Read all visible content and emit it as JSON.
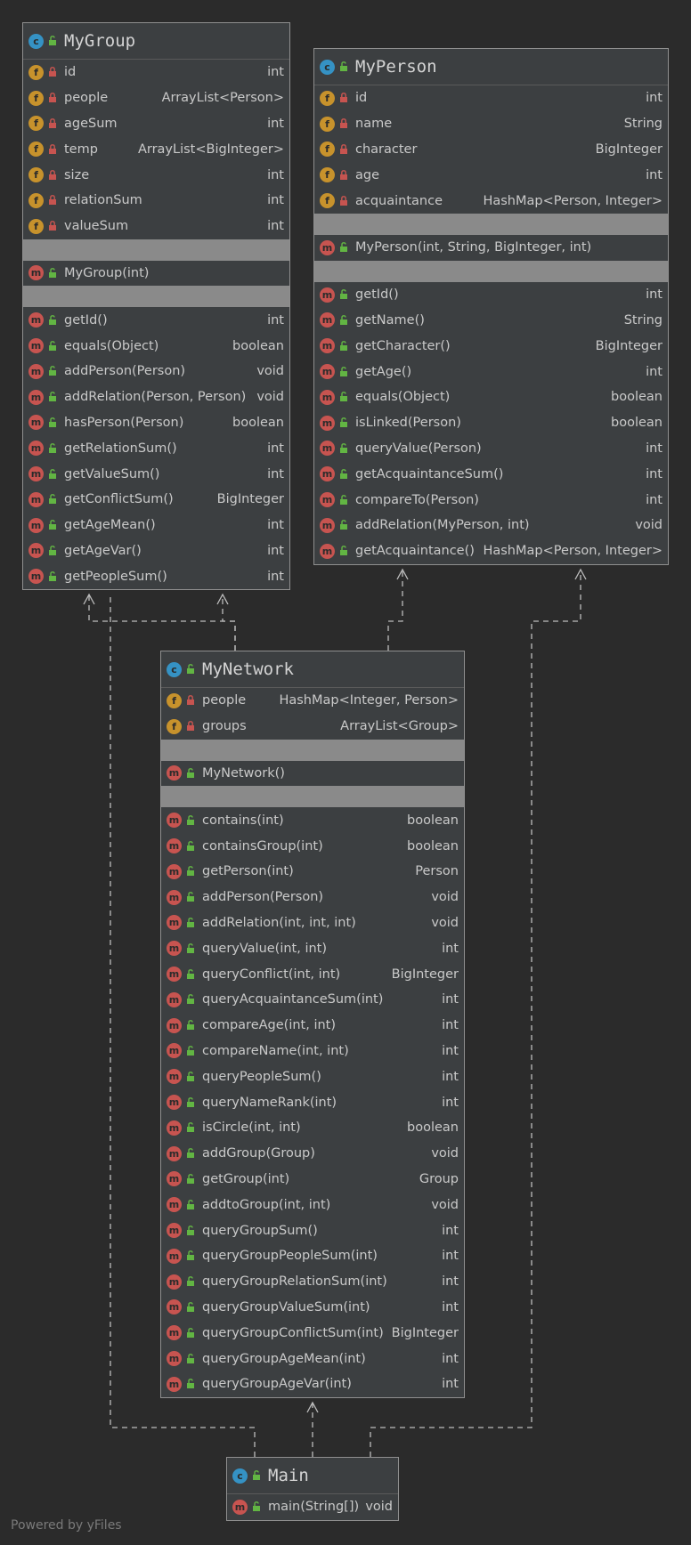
{
  "footer": "Powered by yFiles",
  "colors": {
    "background": "#2b2b2b",
    "box": "#3c3f41",
    "border": "#8f8f8f",
    "class_badge": "#3592c4",
    "field_badge": "#c7922c",
    "method_badge": "#c75450",
    "private_lock": "#c75450",
    "public_lock": "#62b543"
  },
  "icons": {
    "class": "class-badge-icon",
    "field": "field-badge-icon",
    "method": "method-badge-icon",
    "private": "lock-closed-icon",
    "public": "lock-open-icon"
  },
  "classes": {
    "group": {
      "name": "MyGroup",
      "fields": [
        {
          "name": "id",
          "type": "int"
        },
        {
          "name": "people",
          "type": "ArrayList<Person>"
        },
        {
          "name": "ageSum",
          "type": "int"
        },
        {
          "name": "temp",
          "type": "ArrayList<BigInteger>"
        },
        {
          "name": "size",
          "type": "int"
        },
        {
          "name": "relationSum",
          "type": "int"
        },
        {
          "name": "valueSum",
          "type": "int"
        }
      ],
      "constructors": [
        {
          "name": "MyGroup(int)",
          "type": ""
        }
      ],
      "methods": [
        {
          "name": "getId()",
          "type": "int"
        },
        {
          "name": "equals(Object)",
          "type": "boolean"
        },
        {
          "name": "addPerson(Person)",
          "type": "void"
        },
        {
          "name": "addRelation(Person, Person)",
          "type": "void"
        },
        {
          "name": "hasPerson(Person)",
          "type": "boolean"
        },
        {
          "name": "getRelationSum()",
          "type": "int"
        },
        {
          "name": "getValueSum()",
          "type": "int"
        },
        {
          "name": "getConflictSum()",
          "type": "BigInteger"
        },
        {
          "name": "getAgeMean()",
          "type": "int"
        },
        {
          "name": "getAgeVar()",
          "type": "int"
        },
        {
          "name": "getPeopleSum()",
          "type": "int"
        }
      ]
    },
    "person": {
      "name": "MyPerson",
      "fields": [
        {
          "name": "id",
          "type": "int"
        },
        {
          "name": "name",
          "type": "String"
        },
        {
          "name": "character",
          "type": "BigInteger"
        },
        {
          "name": "age",
          "type": "int"
        },
        {
          "name": "acquaintance",
          "type": "HashMap<Person, Integer>"
        }
      ],
      "constructors": [
        {
          "name": "MyPerson(int, String, BigInteger, int)",
          "type": ""
        }
      ],
      "methods": [
        {
          "name": "getId()",
          "type": "int"
        },
        {
          "name": "getName()",
          "type": "String"
        },
        {
          "name": "getCharacter()",
          "type": "BigInteger"
        },
        {
          "name": "getAge()",
          "type": "int"
        },
        {
          "name": "equals(Object)",
          "type": "boolean"
        },
        {
          "name": "isLinked(Person)",
          "type": "boolean"
        },
        {
          "name": "queryValue(Person)",
          "type": "int"
        },
        {
          "name": "getAcquaintanceSum()",
          "type": "int"
        },
        {
          "name": "compareTo(Person)",
          "type": "int"
        },
        {
          "name": "addRelation(MyPerson, int)",
          "type": "void"
        },
        {
          "name": "getAcquaintance()",
          "type": "HashMap<Person, Integer>"
        }
      ]
    },
    "network": {
      "name": "MyNetwork",
      "fields": [
        {
          "name": "people",
          "type": "HashMap<Integer, Person>"
        },
        {
          "name": "groups",
          "type": "ArrayList<Group>"
        }
      ],
      "constructors": [
        {
          "name": "MyNetwork()",
          "type": ""
        }
      ],
      "methods": [
        {
          "name": "contains(int)",
          "type": "boolean"
        },
        {
          "name": "containsGroup(int)",
          "type": "boolean"
        },
        {
          "name": "getPerson(int)",
          "type": "Person"
        },
        {
          "name": "addPerson(Person)",
          "type": "void"
        },
        {
          "name": "addRelation(int, int, int)",
          "type": "void"
        },
        {
          "name": "queryValue(int, int)",
          "type": "int"
        },
        {
          "name": "queryConflict(int, int)",
          "type": "BigInteger"
        },
        {
          "name": "queryAcquaintanceSum(int)",
          "type": "int"
        },
        {
          "name": "compareAge(int, int)",
          "type": "int"
        },
        {
          "name": "compareName(int, int)",
          "type": "int"
        },
        {
          "name": "queryPeopleSum()",
          "type": "int"
        },
        {
          "name": "queryNameRank(int)",
          "type": "int"
        },
        {
          "name": "isCircle(int, int)",
          "type": "boolean"
        },
        {
          "name": "addGroup(Group)",
          "type": "void"
        },
        {
          "name": "getGroup(int)",
          "type": "Group"
        },
        {
          "name": "addtoGroup(int, int)",
          "type": "void"
        },
        {
          "name": "queryGroupSum()",
          "type": "int"
        },
        {
          "name": "queryGroupPeopleSum(int)",
          "type": "int"
        },
        {
          "name": "queryGroupRelationSum(int)",
          "type": "int"
        },
        {
          "name": "queryGroupValueSum(int)",
          "type": "int"
        },
        {
          "name": "queryGroupConflictSum(int)",
          "type": "BigInteger"
        },
        {
          "name": "queryGroupAgeMean(int)",
          "type": "int"
        },
        {
          "name": "queryGroupAgeVar(int)",
          "type": "int"
        }
      ]
    },
    "main": {
      "name": "Main",
      "methods": [
        {
          "name": "main(String[])",
          "type": "void"
        }
      ]
    }
  }
}
